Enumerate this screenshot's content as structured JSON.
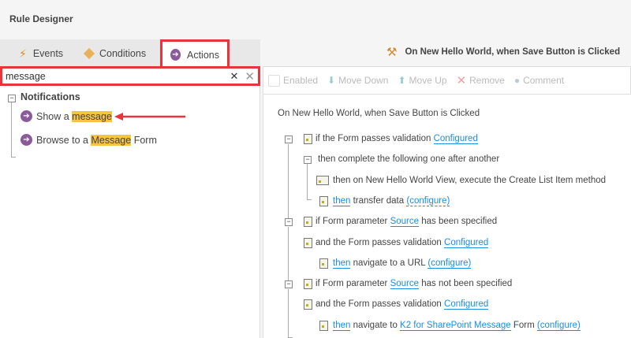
{
  "app": {
    "title": "Rule Designer"
  },
  "tabs": [
    {
      "label": "Events",
      "icon": "lightning-icon"
    },
    {
      "label": "Conditions",
      "icon": "diamond-icon"
    },
    {
      "label": "Actions",
      "icon": "arrow-circle-icon",
      "active": true
    }
  ],
  "search": {
    "value": "message"
  },
  "tree": {
    "group": "Notifications",
    "items": [
      {
        "pre": "Show a ",
        "match": "message",
        "post": ""
      },
      {
        "pre": "Browse to a ",
        "match": "Message",
        "post": " Form"
      }
    ]
  },
  "rule_header": {
    "title": "On New Hello World, when Save Button is Clicked"
  },
  "toolbar": {
    "enabled": "Enabled",
    "move_down": "Move Down",
    "move_up": "Move Up",
    "remove": "Remove",
    "comment": "Comment"
  },
  "rule": {
    "event": "On New Hello World, when Save Button is Clicked",
    "rows": [
      {
        "level": 0,
        "toggle": true,
        "icon": "doc",
        "parts": [
          [
            "if the Form passes validation ",
            ""
          ],
          [
            "Configured",
            "link"
          ]
        ]
      },
      {
        "level": 1,
        "toggle": true,
        "icon": "",
        "parts": [
          [
            "then complete the following one after another",
            ""
          ]
        ]
      },
      {
        "level": 2,
        "icon": "method",
        "parts": [
          [
            "then on New Hello World View, execute the Create List Item method",
            ""
          ]
        ]
      },
      {
        "level": 2,
        "icon": "doc",
        "parts": [
          [
            "then",
            "link"
          ],
          [
            " transfer data ",
            ""
          ],
          [
            "(configure)",
            "dot"
          ]
        ]
      },
      {
        "level": 0,
        "toggle": true,
        "icon": "doc",
        "parts": [
          [
            "if Form parameter ",
            ""
          ],
          [
            "Source",
            "link"
          ],
          [
            " has been specified",
            ""
          ]
        ]
      },
      {
        "level": 0,
        "icon": "doc",
        "parts": [
          [
            "and the Form passes validation ",
            ""
          ],
          [
            "Configured",
            "link"
          ]
        ]
      },
      {
        "level": 2,
        "icon": "doc",
        "parts": [
          [
            "then",
            "link"
          ],
          [
            " navigate to a URL ",
            ""
          ],
          [
            "(configure)",
            "link"
          ]
        ]
      },
      {
        "level": 0,
        "toggle": true,
        "icon": "doc",
        "parts": [
          [
            "if Form parameter ",
            ""
          ],
          [
            "Source",
            "link"
          ],
          [
            " has not been specified",
            ""
          ]
        ]
      },
      {
        "level": 0,
        "icon": "doc",
        "parts": [
          [
            "and the Form passes validation ",
            ""
          ],
          [
            "Configured",
            "link"
          ]
        ]
      },
      {
        "level": 2,
        "icon": "doc",
        "parts": [
          [
            "then",
            "link"
          ],
          [
            " navigate to ",
            ""
          ],
          [
            "K2 for SharePoint Message",
            "link"
          ],
          [
            " Form ",
            ""
          ],
          [
            "(configure)",
            "link"
          ]
        ]
      }
    ]
  },
  "colors": {
    "highlight": "#f6c343",
    "link": "#1a8ee0",
    "callout": "#e8343c"
  }
}
